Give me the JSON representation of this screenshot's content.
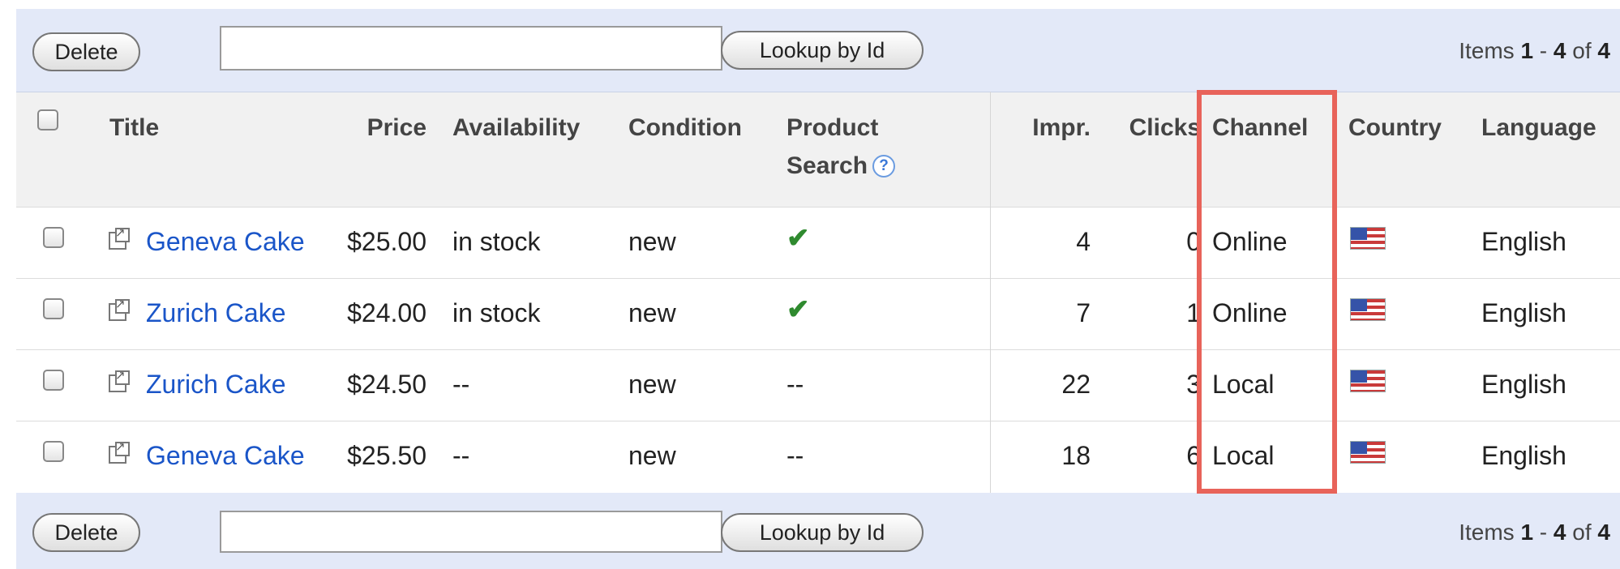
{
  "toolbar_top": {
    "delete_label": "Delete",
    "lookup_label": "Lookup by Id",
    "lookup_value": "",
    "items": {
      "prefix": "Items ",
      "from": "1",
      "dash": " - ",
      "to": "4",
      "of": " of ",
      "total": "4"
    }
  },
  "toolbar_bottom": {
    "delete_label": "Delete",
    "lookup_label": "Lookup by Id",
    "lookup_value": "",
    "items": {
      "prefix": "Items ",
      "from": "1",
      "dash": " - ",
      "to": "4",
      "of": " of ",
      "total": "4"
    }
  },
  "columns": {
    "title": "Title",
    "price": "Price",
    "availability": "Availability",
    "condition": "Condition",
    "product_search_line1": "Product",
    "product_search_line2": "Search",
    "product_search_help": "?",
    "impr": "Impr.",
    "clicks": "Clicks",
    "channel": "Channel",
    "country": "Country",
    "language": "Language"
  },
  "rows": [
    {
      "title": "Geneva Cake",
      "price": "$25.00",
      "availability": "in stock",
      "condition": "new",
      "product_search": "check",
      "product_search_text": "✔",
      "impr": "4",
      "clicks": "0",
      "channel": "Online",
      "country": "us-flag",
      "language": "English"
    },
    {
      "title": "Zurich Cake",
      "price": "$24.00",
      "availability": "in stock",
      "condition": "new",
      "product_search": "check",
      "product_search_text": "✔",
      "impr": "7",
      "clicks": "1",
      "channel": "Online",
      "country": "us-flag",
      "language": "English"
    },
    {
      "title": "Zurich Cake",
      "price": "$24.50",
      "availability": "--",
      "condition": "new",
      "product_search": "--",
      "product_search_text": "--",
      "impr": "22",
      "clicks": "3",
      "channel": "Local",
      "country": "us-flag",
      "language": "English"
    },
    {
      "title": "Geneva Cake",
      "price": "$25.50",
      "availability": "--",
      "condition": "new",
      "product_search": "--",
      "product_search_text": "--",
      "impr": "18",
      "clicks": "6",
      "channel": "Local",
      "country": "us-flag",
      "language": "English"
    }
  ],
  "colors": {
    "link": "#1a55c8",
    "toolbar_bg": "#e3e9f8",
    "highlight": "#e8635a",
    "check": "#2f8a2f"
  }
}
